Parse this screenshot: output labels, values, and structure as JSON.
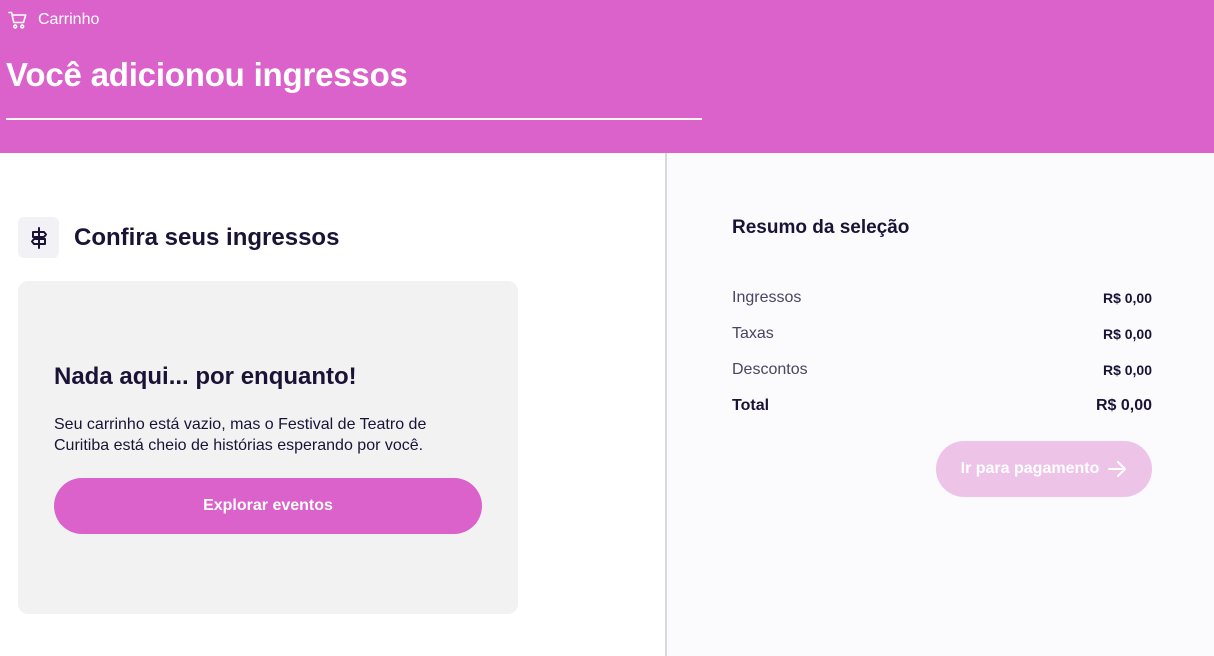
{
  "header": {
    "breadcrumb": {
      "icon": "cart-icon",
      "label": "Carrinho"
    },
    "title": "Você adicionou ingressos",
    "background_color": "#dc62cb"
  },
  "tickets_section": {
    "icon": "signpost-icon",
    "title": "Confira seus ingressos",
    "empty_state": {
      "title": "Nada aqui... por enquanto!",
      "message": "Seu carrinho está vazio, mas o Festival de Teatro de Curitiba está cheio de histórias esperando por você.",
      "button_label": "Explorar eventos"
    }
  },
  "summary": {
    "title": "Resumo da seleção",
    "rows": [
      {
        "label": "Ingressos",
        "value": "R$ 0,00"
      },
      {
        "label": "Taxas",
        "value": "R$ 0,00"
      },
      {
        "label": "Descontos",
        "value": "R$ 0,00"
      }
    ],
    "total": {
      "label": "Total",
      "value": "R$ 0,00"
    },
    "pay_button": {
      "label": "Ir para pagamento",
      "icon": "arrow-right-icon",
      "disabled": true
    }
  },
  "colors": {
    "accent": "#dc62cb",
    "accent_disabled": "#eec3e8",
    "text_dark": "#1b1336",
    "card_bg": "#f2f2f2"
  }
}
